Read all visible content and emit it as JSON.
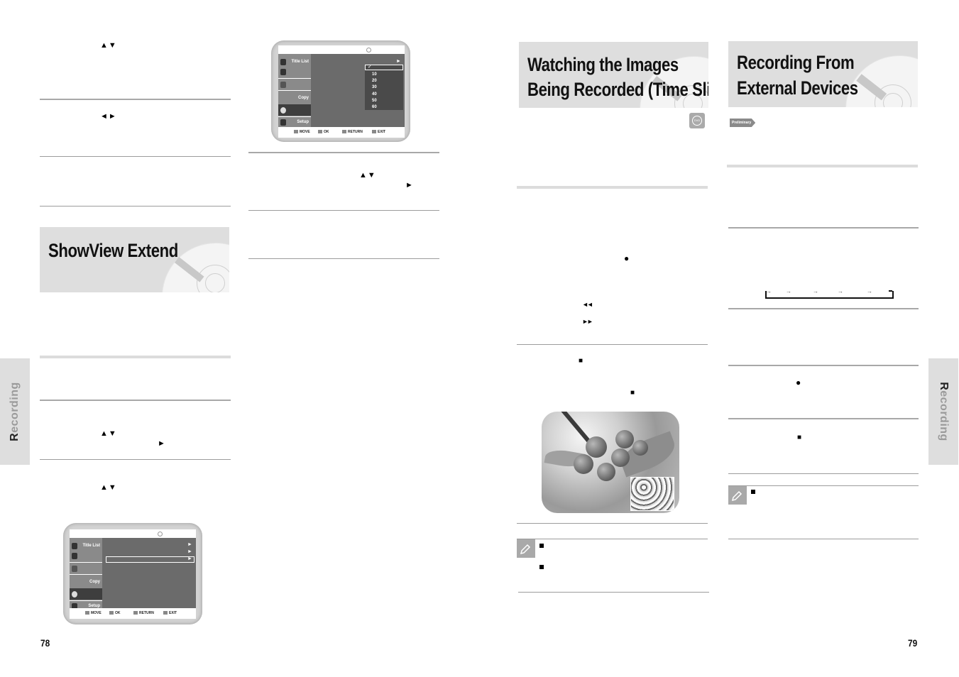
{
  "left_page": {
    "page_number": "78",
    "side_tab": {
      "first_letter": "R",
      "rest": "ecording"
    },
    "section_title": "ShowView  Extend",
    "glyphs": {
      "updown": "▲▼",
      "leftright": "◄►",
      "play": "►"
    },
    "osd_menu_1": {
      "sidebar_items": [
        "Title List",
        "",
        "",
        "Copy",
        "",
        "Setup"
      ],
      "dropdown_selected": "✓",
      "dropdown_options": [
        "10",
        "20",
        "30",
        "40",
        "50",
        "60"
      ],
      "arrow": "►",
      "footer": [
        "MOVE",
        "OK",
        "RETURN",
        "EXIT"
      ]
    },
    "osd_menu_2": {
      "sidebar_items": [
        "Title List",
        "",
        "",
        "Copy",
        "",
        "Setup"
      ],
      "arrows": [
        "►",
        "►",
        "►"
      ],
      "footer": [
        "MOVE",
        "OK",
        "RETURN",
        "EXIT"
      ]
    }
  },
  "right_page": {
    "page_number": "79",
    "side_tab": {
      "first_letter": "R",
      "rest": "ecording"
    },
    "section_1": {
      "title_line1": "Watching the Images",
      "title_line2": "Being Recorded (Time Slip)",
      "disc_badge": "DVD",
      "glyphs": {
        "record": "●",
        "rewind": "◄◄",
        "fast_forward": "►►",
        "stop": "■"
      }
    },
    "section_2": {
      "title_line1": "Recording From",
      "title_line2": "External Devices",
      "badge": "Preliminary",
      "flow_arrows": [
        "→",
        "→",
        "→",
        "→",
        "→"
      ],
      "glyphs": {
        "record": "●",
        "stop": "■"
      }
    },
    "note_bullet": "■"
  }
}
